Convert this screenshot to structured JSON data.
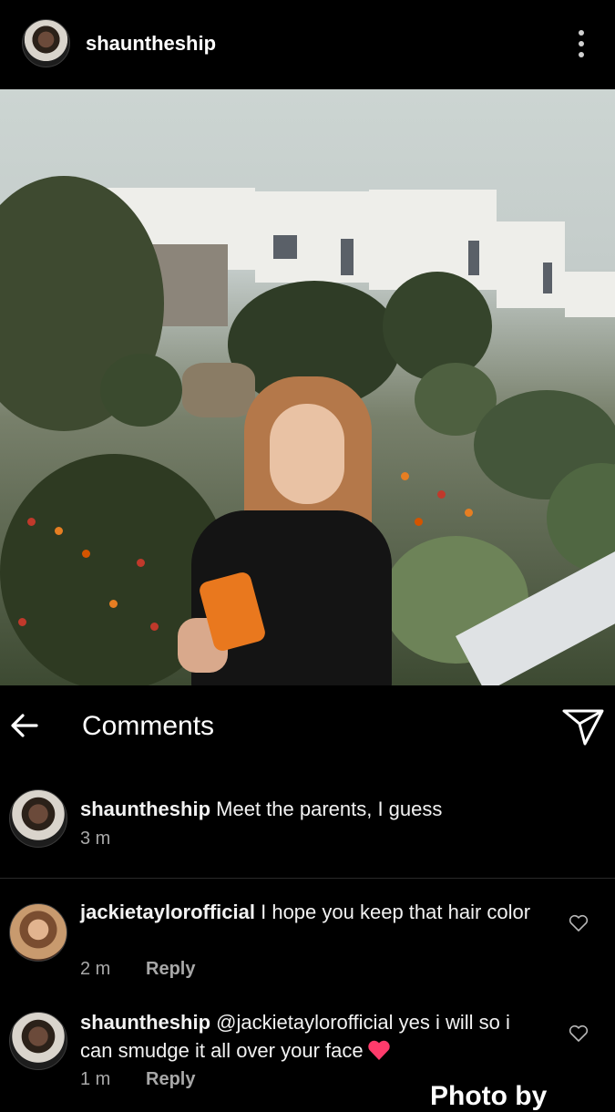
{
  "post": {
    "username": "shauntheship",
    "photo_alt": "Woman with auburn hair in black top holding orange phone in front of white villas and garden"
  },
  "comments_header": {
    "title": "Comments"
  },
  "comments": [
    {
      "username": "shauntheship",
      "text": "Meet the parents, I guess",
      "time": "3 m"
    },
    {
      "username": "jackietaylorofficial",
      "text": "I hope you keep that hair color",
      "time": "2 m",
      "reply": "Reply"
    },
    {
      "username": "shauntheship",
      "text": "@jackietaylorofficial yes i will so i can smudge it all over your face",
      "time": "1 m",
      "reply": "Reply"
    }
  ],
  "footer": {
    "cut_text": "Photo by"
  },
  "colors": {
    "background": "#000000",
    "meta_text": "#a8a8a8",
    "heart_emoji": "#ff3b6b"
  }
}
